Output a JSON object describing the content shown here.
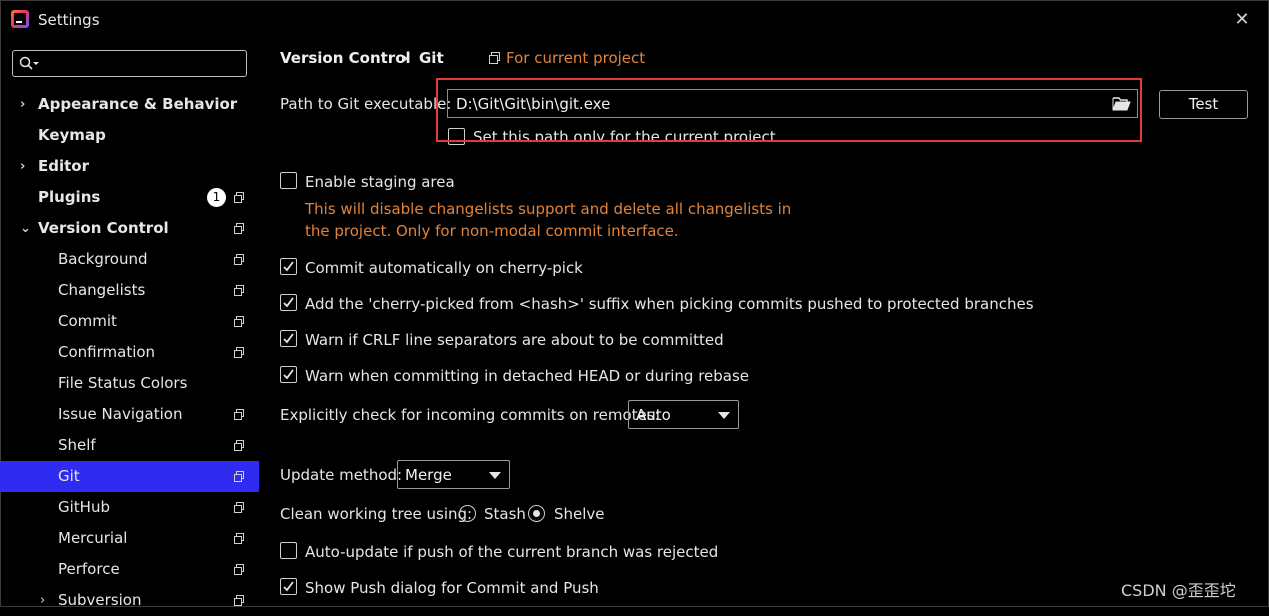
{
  "window": {
    "title": "Settings",
    "close_label": "✕"
  },
  "sidebar": {
    "items": [
      {
        "label": "Appearance & Behavior",
        "chevron": "›",
        "bold": true
      },
      {
        "label": "Keymap",
        "bold": true
      },
      {
        "label": "Editor",
        "chevron": "›",
        "bold": true
      },
      {
        "label": "Plugins",
        "bold": true,
        "badge": "1"
      },
      {
        "label": "Version Control",
        "chevron": "⌄",
        "bold": true
      },
      {
        "label": "Background"
      },
      {
        "label": "Changelists"
      },
      {
        "label": "Commit"
      },
      {
        "label": "Confirmation"
      },
      {
        "label": "File Status Colors"
      },
      {
        "label": "Issue Navigation"
      },
      {
        "label": "Shelf"
      },
      {
        "label": "Git",
        "selected": true
      },
      {
        "label": "GitHub"
      },
      {
        "label": "Mercurial"
      },
      {
        "label": "Perforce"
      },
      {
        "label": "Subversion",
        "chevron": "›"
      }
    ]
  },
  "breadcrumb": {
    "parent": "Version Control",
    "separator": "›",
    "current": "Git",
    "scope_label": "For current project"
  },
  "git_path": {
    "label": "Path to Git executable:",
    "value": "D:\\Git\\Git\\bin\\git.exe",
    "test_button": "Test",
    "current_project_only": {
      "label": "Set this path only for the current project",
      "checked": false
    }
  },
  "options": {
    "staging": {
      "label": "Enable staging area",
      "checked": false,
      "note_line1": "This will disable changelists support and delete all changelists in",
      "note_line2": "the project. Only for non-modal commit interface."
    },
    "cherry_pick_commit": {
      "label": "Commit automatically on cherry-pick",
      "checked": true
    },
    "cherry_pick_suffix": {
      "label": "Add the 'cherry-picked from <hash>' suffix when picking commits pushed to protected branches",
      "checked": true
    },
    "crlf": {
      "label": "Warn if CRLF line separators are about to be committed",
      "checked": true
    },
    "detached_head": {
      "label": "Warn when committing in detached HEAD or during rebase",
      "checked": true
    },
    "incoming": {
      "label": "Explicitly check for incoming commits on remotes:",
      "value": "Auto"
    },
    "update_method": {
      "label": "Update method:",
      "value": "Merge"
    },
    "clean_tree": {
      "label": "Clean working tree using:",
      "stash": "Stash",
      "shelve": "Shelve",
      "selected": "Shelve"
    },
    "auto_update": {
      "label": "Auto-update if push of the current branch was rejected",
      "checked": false
    },
    "push_dialog": {
      "label": "Show Push dialog for Commit and Push",
      "checked": true
    }
  },
  "watermark": "CSDN @歪歪坨",
  "colors": {
    "accent_orange": "#e0833b",
    "selection_blue": "#2f2bf1",
    "highlight_red": "#e13c3c"
  }
}
